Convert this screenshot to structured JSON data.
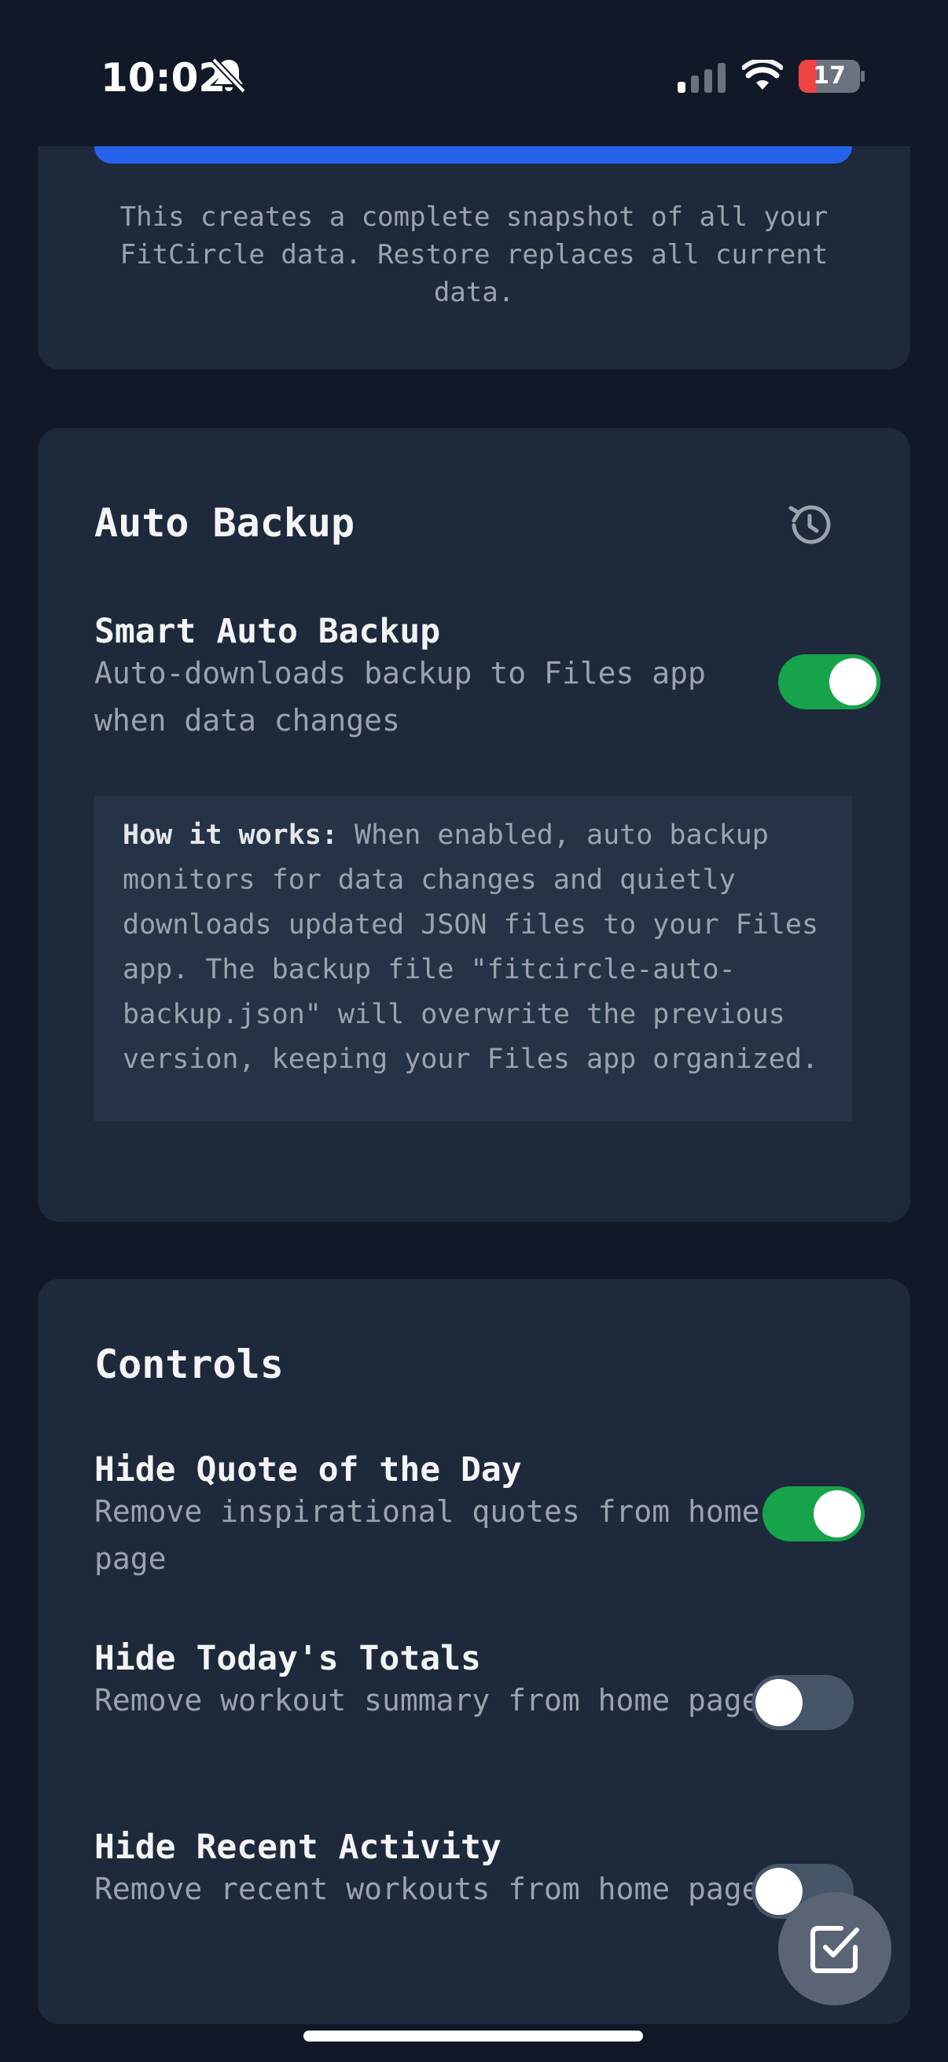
{
  "status_bar": {
    "time": "10:02",
    "battery": "17"
  },
  "top_card": {
    "note": "This creates a complete snapshot of all your FitCircle data. Restore replaces all current data."
  },
  "auto_backup": {
    "title": "Auto Backup",
    "setting_title": "Smart Auto Backup",
    "setting_desc": "Auto-downloads backup to Files app when data changes",
    "enabled": true,
    "info_label": "How it works:",
    "info_text": "When enabled, auto backup monitors for data changes and quietly downloads updated JSON files to your Files app. The backup file \"fitcircle-auto-backup.json\" will overwrite the previous version, keeping your Files app organized."
  },
  "controls": {
    "title": "Controls",
    "items": [
      {
        "title": "Hide Quote of the Day",
        "desc": "Remove inspirational quotes from home page",
        "enabled": true
      },
      {
        "title": "Hide Today's Totals",
        "desc": "Remove workout summary from home page",
        "enabled": false
      },
      {
        "title": "Hide Recent Activity",
        "desc": "Remove recent workouts from home page",
        "enabled": false
      }
    ]
  },
  "icons": {
    "bell": "bell-off-icon",
    "history": "history-icon",
    "fab": "check-square-icon"
  },
  "colors": {
    "background": "#111827",
    "card": "#1e293b",
    "accent_blue": "#2563eb",
    "toggle_on": "#16a34a",
    "toggle_off": "#475569"
  }
}
